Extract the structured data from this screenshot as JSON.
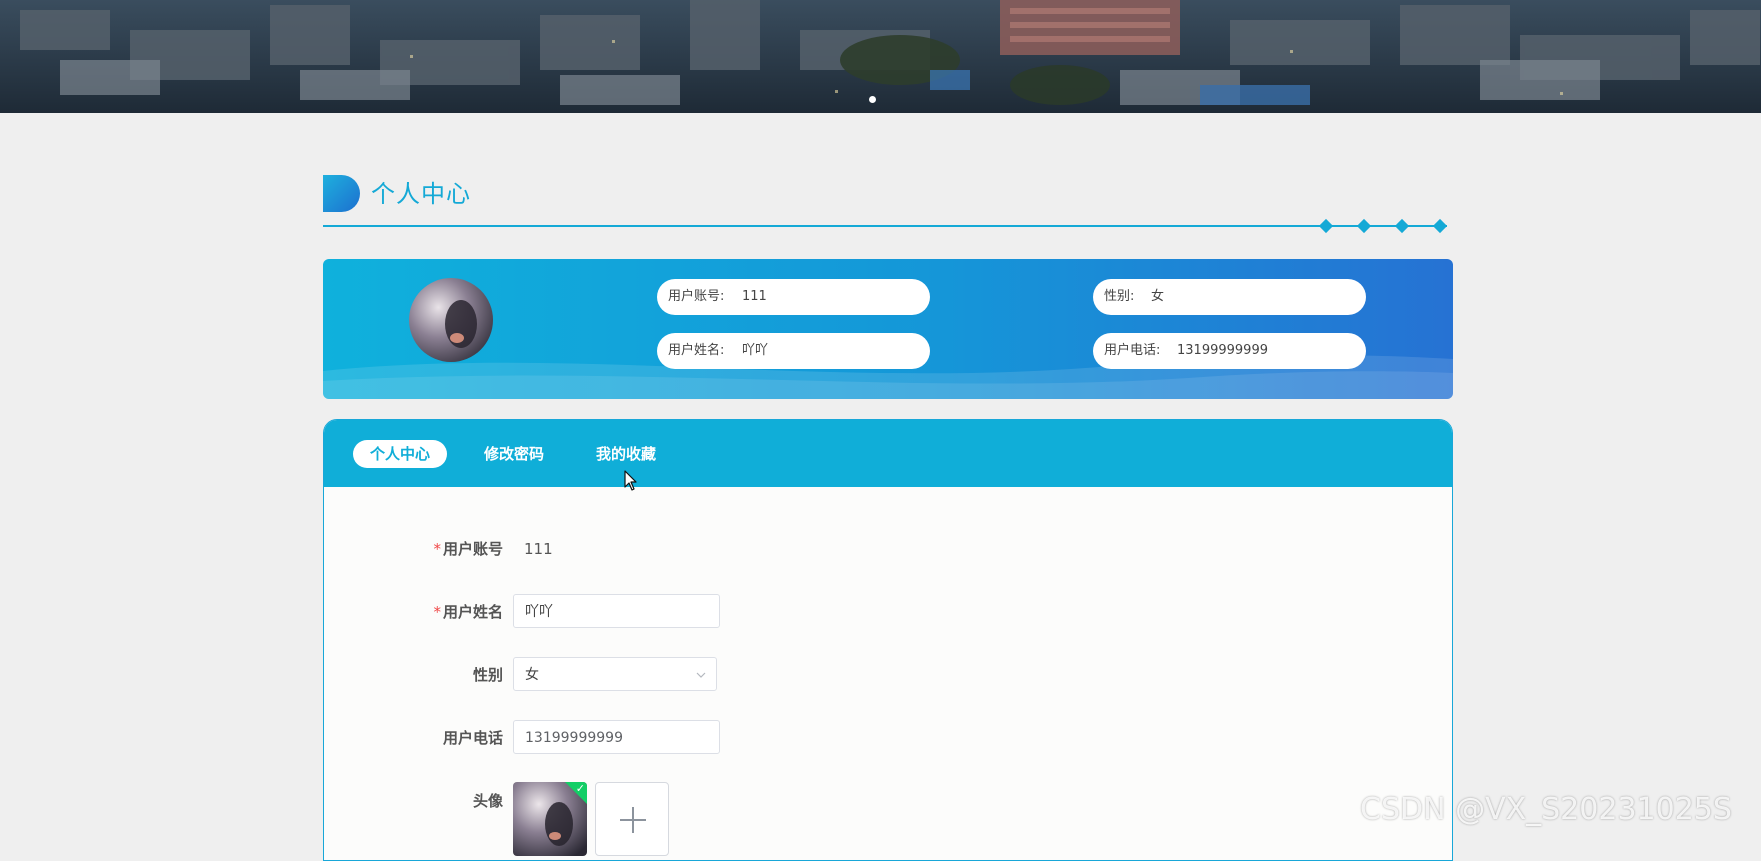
{
  "section": {
    "title": "个人中心"
  },
  "profile_card": {
    "account_label": "用户账号:",
    "account_value": "111",
    "gender_label": "性别:",
    "gender_value": "女",
    "name_label": "用户姓名:",
    "name_value": "吖吖",
    "phone_label": "用户电话:",
    "phone_value": "13199999999"
  },
  "tabs": [
    {
      "label": "个人中心",
      "active": true
    },
    {
      "label": "修改密码",
      "active": false
    },
    {
      "label": "我的收藏",
      "active": false
    }
  ],
  "form": {
    "account_label": "用户账号",
    "account_value": "111",
    "name_label": "用户姓名",
    "name_value": "吖吖",
    "gender_label": "性别",
    "gender_value": "女",
    "phone_label": "用户电话",
    "phone_value": "13199999999",
    "avatar_label": "头像",
    "required_mark": "*"
  },
  "watermark": "CSDN @VX_S20231025S",
  "colors": {
    "primary": "#14a9d6",
    "tab_bar": "#10aed8",
    "required": "#f04848",
    "upload_success": "#13ce66"
  },
  "icons": {
    "title_badge": "half-circle-badge-icon",
    "select_arrow": "chevron-down-icon",
    "upload_add": "plus-icon",
    "upload_ok": "check-icon"
  }
}
